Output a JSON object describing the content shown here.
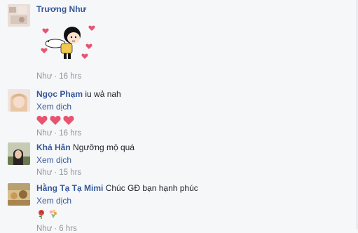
{
  "comments": [
    {
      "author": "Trương Như",
      "text": "",
      "meta_action": "Như",
      "meta_time": "16 hrs",
      "sticker": "girl-hugging-bunny-with-hearts"
    },
    {
      "author": "Ngọc Phạm",
      "text": "iu wả nah",
      "translate": "Xem dịch",
      "reactions": [
        "heart-emoji",
        "heart-emoji",
        "heart-emoji"
      ],
      "meta_action": "Như",
      "meta_time": "16 hrs"
    },
    {
      "author": "Khả Hân",
      "text": "Ngưỡng mộ quá",
      "translate": "Xem dịch",
      "meta_action": "Như",
      "meta_time": "15 hrs"
    },
    {
      "author": "Hằng Tạ Tạ Mimi",
      "text": "Chúc GĐ bạn hạnh phúc",
      "translate": "Xem dịch",
      "reactions": [
        "rose-emoji",
        "bouquet-emoji"
      ],
      "meta_action": "Như",
      "meta_time": "6 hrs"
    }
  ],
  "colors": {
    "link": "#365899",
    "muted": "#90949c",
    "heart": "#e8546f"
  }
}
